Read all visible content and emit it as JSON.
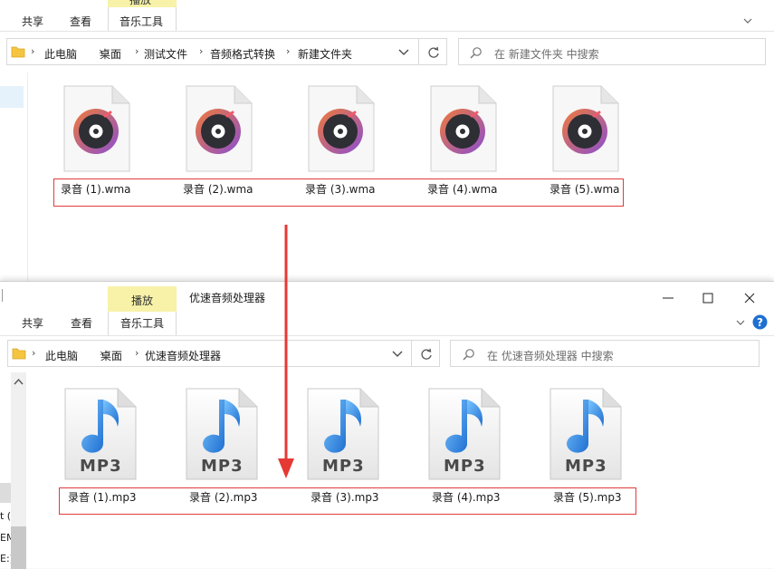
{
  "top_window": {
    "tab_play": "播放",
    "tabs": [
      "共享",
      "查看",
      "音乐工具"
    ],
    "breadcrumb": [
      "此电脑",
      "桌面",
      "测试文件",
      "音频格式转换",
      "新建文件夹"
    ],
    "search_placeholder": "在 新建文件夹 中搜索",
    "files": [
      "录音 (1).wma",
      "录音 (2).wma",
      "录音 (3).wma",
      "录音 (4).wma",
      "录音 (5).wma"
    ]
  },
  "bottom_window": {
    "tab_play": "播放",
    "title": "优速音频处理器",
    "tabs": [
      "共享",
      "查看",
      "音乐工具"
    ],
    "breadcrumb": [
      "此电脑",
      "桌面",
      "优速音频处理器"
    ],
    "search_placeholder": "在 优速音频处理器 中搜索",
    "files": [
      "录音 (1).mp3",
      "录音 (2).mp3",
      "录音 (3).mp3",
      "录音 (4).mp3",
      "录音 (5).mp3"
    ],
    "mp3_badge": "MP3",
    "sidebar_fragments": [
      "t (",
      "EM",
      "E:)"
    ]
  },
  "colors": {
    "highlight_border": "#e03b3b",
    "arrow": "#e53935",
    "play_tab": "#f7f2a8",
    "help": "#1f6fd1",
    "music_note": "#2f8ee6"
  }
}
